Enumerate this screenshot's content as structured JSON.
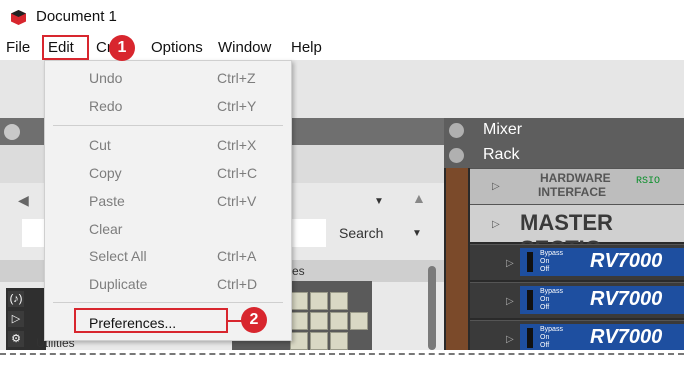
{
  "window": {
    "title": "Document 1"
  },
  "menubar": {
    "items": [
      "File",
      "Edit",
      "Create",
      "Options",
      "Window",
      "Help"
    ]
  },
  "edit_menu": {
    "items": [
      {
        "label": "Undo",
        "shortcut": "Ctrl+Z"
      },
      {
        "label": "Redo",
        "shortcut": "Ctrl+Y"
      },
      {
        "label": "Cut",
        "shortcut": "Ctrl+X"
      },
      {
        "label": "Copy",
        "shortcut": "Ctrl+C"
      },
      {
        "label": "Paste",
        "shortcut": "Ctrl+V"
      },
      {
        "label": "Clear",
        "shortcut": ""
      },
      {
        "label": "Select All",
        "shortcut": "Ctrl+A"
      },
      {
        "label": "Duplicate",
        "shortcut": "Ctrl+D"
      },
      {
        "label": "Preferences...",
        "shortcut": ""
      }
    ]
  },
  "annotations": {
    "step1": "1",
    "step2": "2"
  },
  "browser": {
    "search_label": "Search",
    "utilities_label": "Utilities"
  },
  "rack": {
    "mixer_label": "Mixer",
    "rack_label": "Rack",
    "hardware_line1": "HARDWARE",
    "hardware_line2": "INTERFACE",
    "rsio": "RSIO",
    "master_section": "MASTER SECTIO",
    "bypass_lines": [
      "Bypass",
      "On",
      "Off"
    ],
    "rv_units": [
      "RV7000",
      "RV7000",
      "RV7000"
    ]
  },
  "colors": {
    "annotation_red": "#d8262e",
    "rv_blue": "#1e4fa0"
  }
}
